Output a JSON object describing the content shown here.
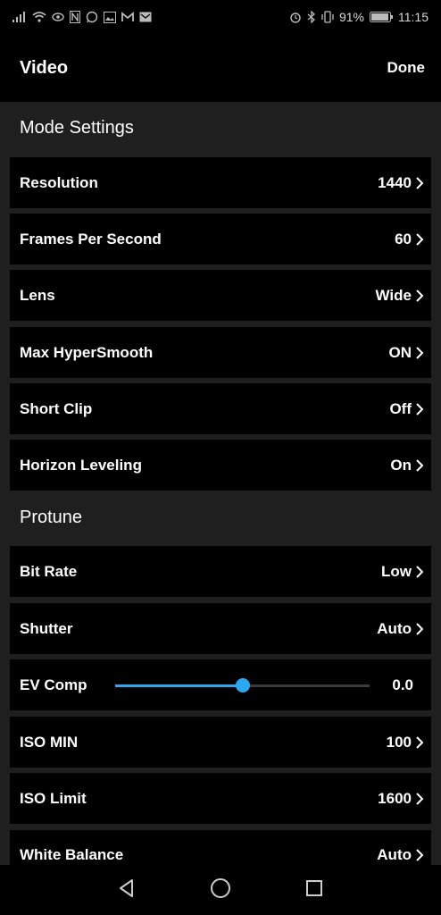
{
  "status": {
    "battery": "91%",
    "time": "11:15"
  },
  "header": {
    "title": "Video",
    "done_label": "Done"
  },
  "sections": {
    "mode_settings": "Mode Settings",
    "protune": "Protune"
  },
  "mode_rows": [
    {
      "label": "Resolution",
      "value": "1440"
    },
    {
      "label": "Frames Per Second",
      "value": "60"
    },
    {
      "label": "Lens",
      "value": "Wide"
    },
    {
      "label": "Max HyperSmooth",
      "value": "ON"
    },
    {
      "label": "Short Clip",
      "value": "Off"
    },
    {
      "label": "Horizon Leveling",
      "value": "On"
    }
  ],
  "protune_rows": [
    {
      "label": "Bit Rate",
      "value": "Low"
    },
    {
      "label": "Shutter",
      "value": "Auto"
    },
    {
      "label": "EV Comp",
      "value": "0.0",
      "slider_fraction": 0.5
    },
    {
      "label": "ISO MIN",
      "value": "100"
    },
    {
      "label": "ISO Limit",
      "value": "1600"
    },
    {
      "label": "White Balance",
      "value": "Auto"
    }
  ],
  "colors": {
    "accent": "#2aa8f2",
    "background": "#1f1f1f",
    "row_background": "#000000"
  },
  "icons": [
    "signal-icon",
    "wifi-icon",
    "eye-icon",
    "n-icon",
    "whatsapp-icon",
    "gallery-icon",
    "gmail-icon",
    "mail-icon",
    "alarm-icon",
    "bluetooth-icon",
    "vibrate-icon",
    "battery-icon",
    "back-icon",
    "home-icon",
    "recents-icon"
  ]
}
